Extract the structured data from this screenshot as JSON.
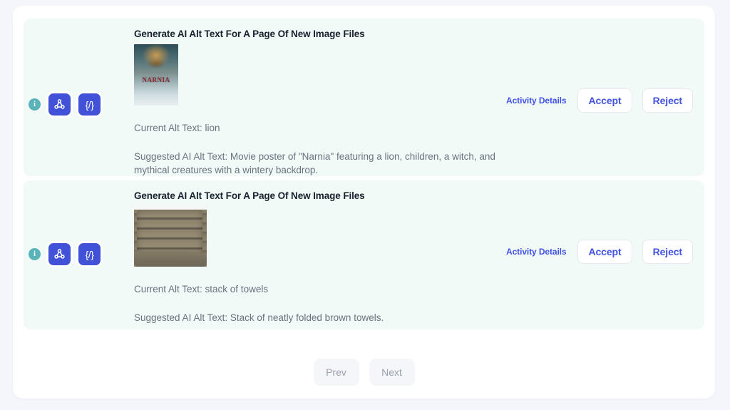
{
  "theme": {
    "page_background": "#f4f6fc",
    "card_background": "#ffffff",
    "row_background": "#f1faf6",
    "accent_blue": "#4152e6",
    "icon_tile_blue": "#4152d8",
    "info_teal": "#5bb3ba",
    "body_text": "#6a7280",
    "title_text": "#18222f",
    "disabled_text": "#9aa1ad"
  },
  "activities": [
    {
      "info_icon": "info-circle-icon",
      "webhook_icon": "webhook-icon",
      "code_icon": "code-braces-icon",
      "code_icon_label": "{/}",
      "title": "Generate AI Alt Text For A Page Of New Image Files",
      "thumbnail_alt": "Movie poster of Narnia featuring a lion",
      "current_alt_text": "Current Alt Text: lion",
      "suggested_alt_text": "Suggested AI Alt Text: Movie poster of \"Narnia\" featuring a lion, children, a witch, and mythical creatures with a wintery backdrop.",
      "details_link": "Activity Details",
      "accept_label": "Accept",
      "reject_label": "Reject"
    },
    {
      "info_icon": "info-circle-icon",
      "webhook_icon": "webhook-icon",
      "code_icon": "code-braces-icon",
      "code_icon_label": "{/}",
      "title": "Generate AI Alt Text For A Page Of New Image Files",
      "thumbnail_alt": "Stack of neatly folded brown towels",
      "current_alt_text": "Current Alt Text: stack of towels",
      "suggested_alt_text": "Suggested AI Alt Text: Stack of neatly folded brown towels.",
      "details_link": "Activity Details",
      "accept_label": "Accept",
      "reject_label": "Reject"
    }
  ],
  "pagination": {
    "prev_label": "Prev",
    "next_label": "Next",
    "prev_disabled": true,
    "next_disabled": true
  }
}
